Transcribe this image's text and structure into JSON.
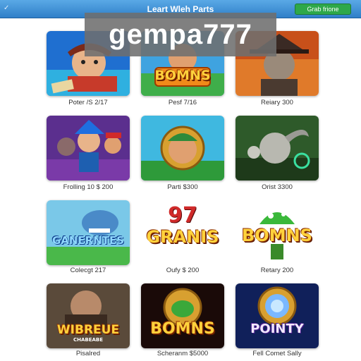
{
  "header": {
    "check_mark": "✓",
    "title": "Leart Wleh Parts",
    "button_label": "Grab frione"
  },
  "watermark": "gempa777",
  "games": [
    {
      "caption": "Poter /S 2/17",
      "banner": "",
      "theme": "pirate"
    },
    {
      "caption": "Pesf 7/16",
      "banner": "BOMNS",
      "theme": "bomns"
    },
    {
      "caption": "Reiary 300",
      "banner": "",
      "theme": "witch"
    },
    {
      "caption": "Frolling 10 $ 200",
      "banner": "",
      "theme": "heroes"
    },
    {
      "caption": "Parti $300",
      "banner": "",
      "theme": "frame"
    },
    {
      "caption": "Orist 3300",
      "banner": "",
      "theme": "goblin"
    },
    {
      "caption": "Colecgt 217",
      "banner": "GANERNTES",
      "theme": "creature"
    },
    {
      "caption": "Oufy $ 200",
      "banner": "GRANIS",
      "theme": "granis"
    },
    {
      "caption": "Retary 200",
      "banner": "BOMNS",
      "theme": "mushroom"
    },
    {
      "caption": "Pisalred",
      "banner": "WIBREUE",
      "sub_banner": "CHABEABE",
      "theme": "brute"
    },
    {
      "caption": "Scheranm $5000",
      "banner": "BOMNS",
      "theme": "bomns2"
    },
    {
      "caption": "Fell Comet Sally",
      "banner": "POINTY",
      "theme": "pointy"
    }
  ],
  "top_banner_numeral": "97",
  "colors": {
    "header": "#2f7fc8",
    "button": "#2ea84a"
  }
}
